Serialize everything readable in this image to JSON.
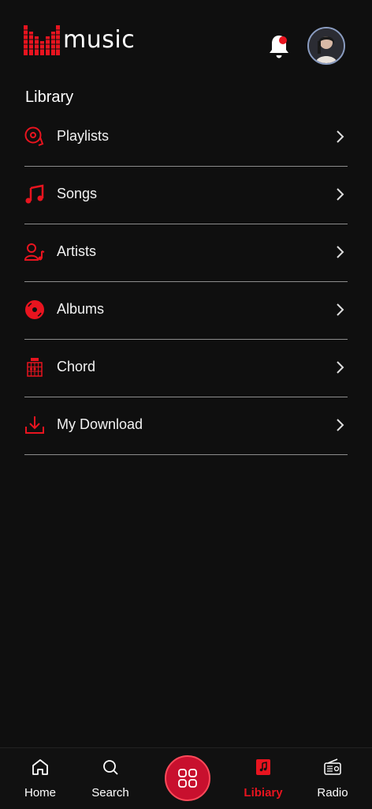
{
  "app": {
    "logo_text": "music",
    "brand_color": "#e8141f"
  },
  "header": {
    "notification_icon": "bell-icon",
    "has_notification": true,
    "avatar_icon": "user-avatar"
  },
  "library": {
    "title": "Library",
    "items": [
      {
        "label": "Playlists",
        "icon": "vinyl-playlist-icon"
      },
      {
        "label": "Songs",
        "icon": "music-note-icon"
      },
      {
        "label": "Artists",
        "icon": "artist-icon"
      },
      {
        "label": "Albums",
        "icon": "album-disc-icon"
      },
      {
        "label": "Chord",
        "icon": "chord-chart-icon"
      },
      {
        "label": "My Download",
        "icon": "download-icon"
      }
    ]
  },
  "bottom_nav": {
    "items": [
      {
        "label": "Home",
        "icon": "home-icon"
      },
      {
        "label": "Search",
        "icon": "search-icon"
      },
      {
        "label": "Libiary",
        "icon": "library-icon",
        "active": true
      },
      {
        "label": "Radio",
        "icon": "radio-icon"
      }
    ],
    "center_icon": "grid-icon"
  }
}
